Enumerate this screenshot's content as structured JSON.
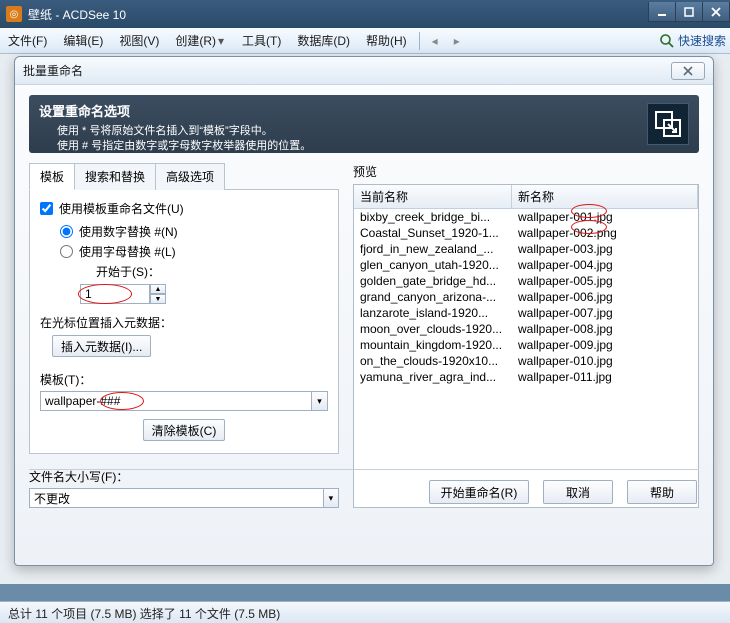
{
  "window": {
    "title": "壁纸 - ACDSee 10"
  },
  "menu": {
    "file": "文件(F)",
    "edit": "编辑(E)",
    "view": "视图(V)",
    "create": "创建(R)",
    "tools": "工具(T)",
    "database": "数据库(D)",
    "help": "帮助(H)",
    "quick_search": "快速搜索"
  },
  "statusbar": {
    "text": "总计 11 个项目 (7.5 MB)     选择了 11 个文件 (7.5 MB)"
  },
  "dialog": {
    "title": "批量重命名",
    "header": {
      "title": "设置重命名选项",
      "line1": "使用 * 号将原始文件名插入到“模板”字段中。",
      "line2": "使用 # 号指定由数字或字母数字枚举器使用的位置。"
    },
    "tabs": {
      "template": "模板",
      "search_replace": "搜索和替换",
      "advanced": "高级选项"
    },
    "use_template": "使用模板重命名文件(U)",
    "radio_numeric": "使用数字替换 #(N)",
    "radio_alpha": "使用字母替换 #(L)",
    "start_at_label": "开始于(S)：",
    "start_at_value": "1",
    "meta_label": "在光标位置插入元数据：",
    "insert_meta_btn": "插入元数据(I)...",
    "template_label": "模板(T)：",
    "template_value": "wallpaper-###",
    "clear_btn": "清除模板(C)",
    "case_label": "文件名大小写(F)：",
    "case_value": "不更改",
    "preview_title": "预览",
    "col_current": "当前名称",
    "col_new": "新名称",
    "rows": [
      {
        "cur": "bixby_creek_bridge_bi...",
        "new": "wallpaper-001.jpg"
      },
      {
        "cur": "Coastal_Sunset_1920-1...",
        "new": "wallpaper-002.png"
      },
      {
        "cur": "fjord_in_new_zealand_...",
        "new": "wallpaper-003.jpg"
      },
      {
        "cur": "glen_canyon_utah-1920...",
        "new": "wallpaper-004.jpg"
      },
      {
        "cur": "golden_gate_bridge_hd...",
        "new": "wallpaper-005.jpg"
      },
      {
        "cur": "grand_canyon_arizona-...",
        "new": "wallpaper-006.jpg"
      },
      {
        "cur": "lanzarote_island-1920...",
        "new": "wallpaper-007.jpg"
      },
      {
        "cur": "moon_over_clouds-1920...",
        "new": "wallpaper-008.jpg"
      },
      {
        "cur": "mountain_kingdom-1920...",
        "new": "wallpaper-009.jpg"
      },
      {
        "cur": "on_the_clouds-1920x10...",
        "new": "wallpaper-010.jpg"
      },
      {
        "cur": "yamuna_river_agra_ind...",
        "new": "wallpaper-011.jpg"
      }
    ],
    "buttons": {
      "start": "开始重命名(R)",
      "cancel": "取消",
      "help": "帮助"
    }
  }
}
